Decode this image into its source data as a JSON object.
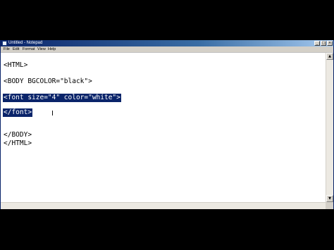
{
  "window": {
    "title": "Untitled - Notepad",
    "minimize_glyph": "_",
    "maximize_glyph": "□",
    "close_glyph": "×"
  },
  "menu": {
    "items": [
      "File",
      "Edit",
      "Format",
      "View",
      "Help"
    ]
  },
  "editor": {
    "lines": [
      "<HTML>",
      "<BODY BGCOLOR=\"black\">",
      "<font size=\"4\" color=\"white\">",
      "</font>",
      "</BODY>",
      "</HTML>"
    ],
    "selected_lines": [
      2,
      3
    ]
  },
  "scrollbars": {
    "up_glyph": "▲",
    "down_glyph": "▼"
  },
  "colors": {
    "selection": "#0a246a",
    "titlebar": "#0a246a",
    "background": "#000000"
  }
}
